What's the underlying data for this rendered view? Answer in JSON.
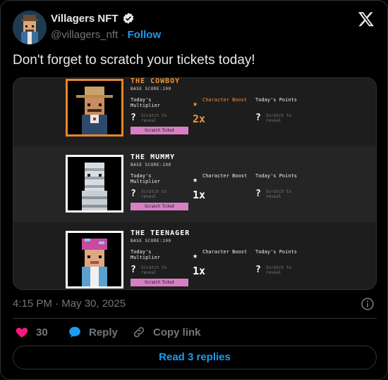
{
  "author": {
    "display_name": "Villagers NFT",
    "handle": "@villagers_nft",
    "separator": "·",
    "follow_label": "Follow"
  },
  "tweet": {
    "text": "Don't forget to scratch your tickets today!",
    "timestamp": "4:15 PM · May 30, 2025"
  },
  "cards": [
    {
      "name": "THE COWBOY",
      "base_score": "BASE SCORE:100",
      "multiplier_label": "Today's Multiplier",
      "multiplier_value": "?",
      "multiplier_note": "Scratch to reveal",
      "boost_label": "Character Boost",
      "boost_value": "2x",
      "points_label": "Today's Points",
      "points_value": "?",
      "points_note": "Scratch to reveal",
      "button_label": "Scratch Ticket"
    },
    {
      "name": "THE MUMMY",
      "base_score": "BASE SCORE:100",
      "multiplier_label": "Today's Multiplier",
      "multiplier_value": "?",
      "multiplier_note": "Scratch to reveal",
      "boost_label": "Character Boost",
      "boost_value": "1x",
      "points_label": "Today's Points",
      "points_value": "?",
      "points_note": "Scratch to reveal",
      "button_label": "Scratch Ticket"
    },
    {
      "name": "THE TEENAGER",
      "base_score": "BASE SCORE:100",
      "multiplier_label": "Today's Multiplier",
      "multiplier_value": "?",
      "multiplier_note": "Scratch to reveal",
      "boost_label": "Character Boost",
      "boost_value": "1x",
      "points_label": "Today's Points",
      "points_value": "?",
      "points_note": "Scratch to reveal",
      "button_label": "Scratch Ticket"
    }
  ],
  "actions": {
    "like_count": "30",
    "reply_label": "Reply",
    "copy_label": "Copy link",
    "read_replies_label": "Read 3 replies"
  },
  "icons": {
    "verified": "verified-badge-icon",
    "x_logo": "x-logo-icon",
    "info": "info-icon",
    "heart": "heart-icon",
    "reply": "reply-bubble-icon",
    "copy": "link-icon",
    "star": "star-icon"
  },
  "colors": {
    "background": "#000000",
    "accent_blue": "#1d9bf0",
    "like_pink": "#f91880",
    "highlight_orange": "#f0923a",
    "button_pink": "#d87fc4"
  }
}
